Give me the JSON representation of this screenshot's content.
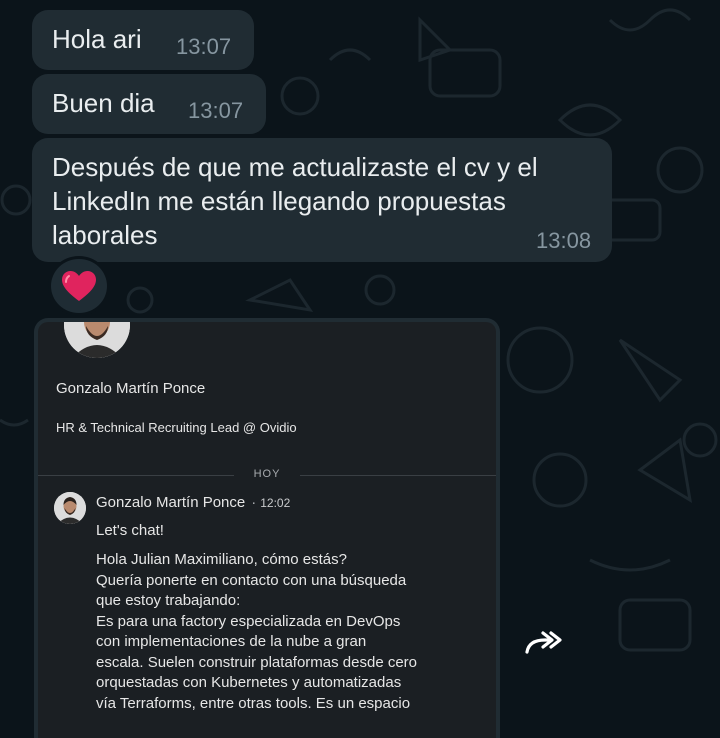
{
  "messages": [
    {
      "text": "Hola ari",
      "time": "13:07"
    },
    {
      "text": "Buen dia",
      "time": "13:07"
    },
    {
      "lines": [
        "Después de que me actualizaste el cv y el",
        "LinkedIn me están llegando propuestas",
        "laborales"
      ],
      "time": "13:08"
    }
  ],
  "reaction": {
    "icon": "red-heart-icon",
    "color": "#e0245e"
  },
  "shared_screenshot": {
    "profile_name": "Gonzalo Martín Ponce",
    "profile_headline": "HR & Technical Recruiting Lead @ Ovidio",
    "day_label": "HOY",
    "sender_name": "Gonzalo Martín Ponce",
    "sender_time": "12:02",
    "subject": "Let's chat!",
    "body_lines": [
      "Hola Julian Maximiliano, cómo estás?",
      "Quería ponerte en contacto con una búsqueda",
      "que estoy trabajando:",
      "Es para una factory especializada en DevOps",
      "con implementaciones de la nube a gran",
      "escala. Suelen construir plataformas desde cero",
      "orquestadas con Kubernetes y automatizadas",
      "vía Terraforms, entre otras tools. Es un espacio"
    ]
  },
  "forward_button": {
    "icon": "forward-icon"
  },
  "colors": {
    "background": "#0b141a",
    "bubble": "#202c33",
    "text": "#e9edef",
    "meta": "#8696a0"
  }
}
